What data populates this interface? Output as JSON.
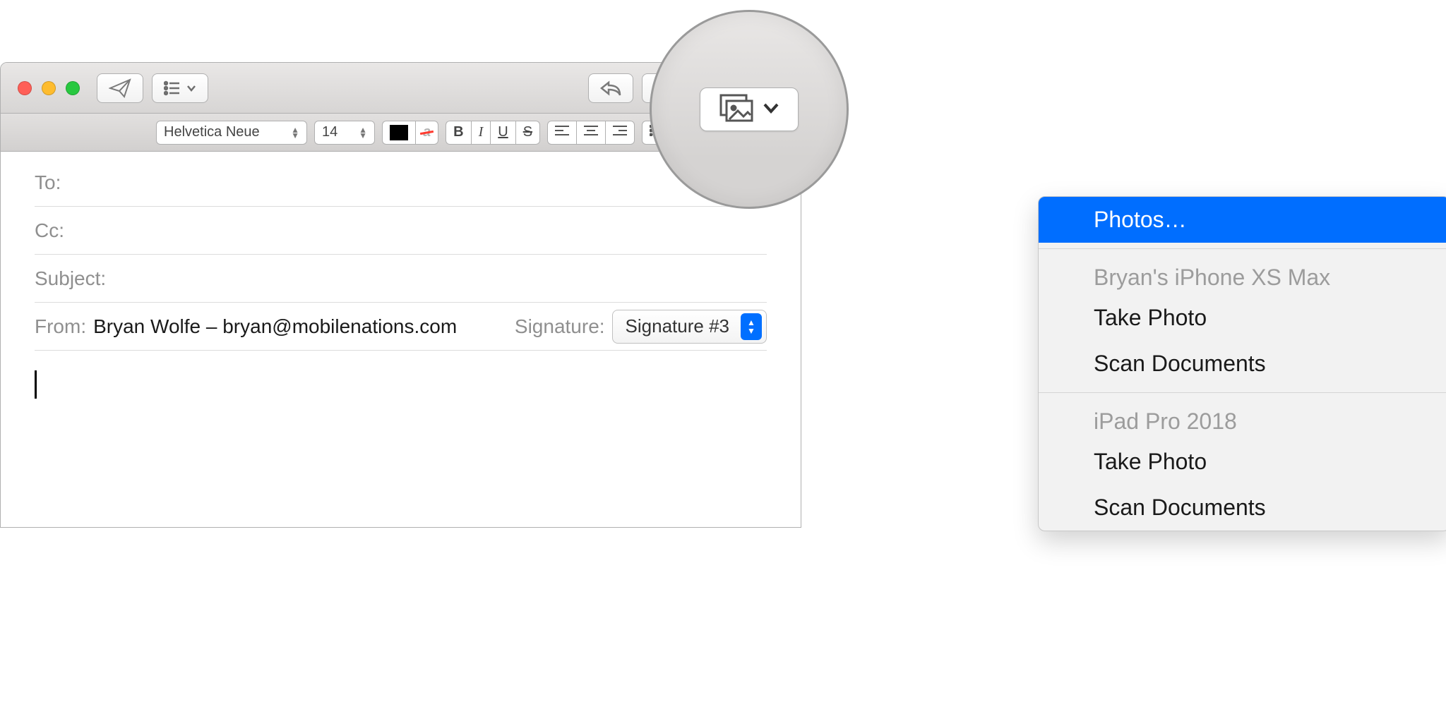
{
  "toolbar": {
    "send_icon": "send",
    "header_fields_icon": "header-fields",
    "reply_icon": "reply",
    "attach_icon": "attach",
    "markup_icon": "markup",
    "format_icon": "format",
    "photo_icon": "photo-browser"
  },
  "format": {
    "font_name": "Helvetica Neue",
    "font_size": "14",
    "bold": "B",
    "italic": "I",
    "underline": "U",
    "strike": "S"
  },
  "fields": {
    "to_label": "To:",
    "cc_label": "Cc:",
    "subject_label": "Subject:",
    "from_label": "From:",
    "from_value": "Bryan Wolfe – bryan@mobilenations.com",
    "signature_label": "Signature:",
    "signature_value": "Signature #3"
  },
  "ctx": {
    "photos": "Photos…",
    "device1": "Bryan's iPhone XS Max",
    "take_photo": "Take Photo",
    "scan_documents": "Scan Documents",
    "device2": "iPad Pro 2018"
  }
}
